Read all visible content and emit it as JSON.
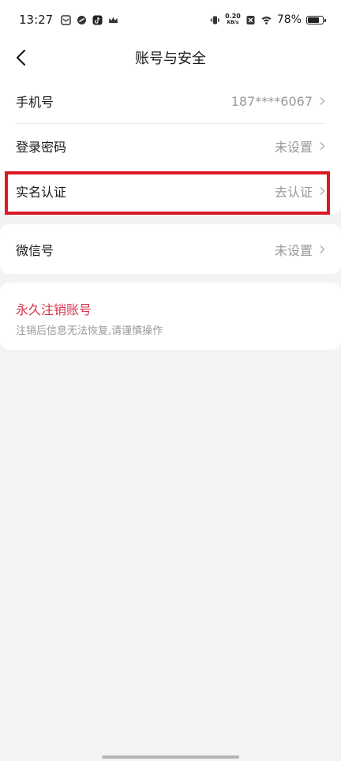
{
  "status_bar": {
    "time": "13:27",
    "net_speed_value": "0.20",
    "net_speed_unit": "KB/s",
    "battery_percent": "78%",
    "battery_level": 0.78,
    "icons": [
      "mail-icon",
      "link-icon",
      "tiktok-icon",
      "crown-icon",
      "vibrate-icon",
      "sim-off-icon",
      "wifi-icon",
      "battery-icon"
    ]
  },
  "header": {
    "title": "账号与安全"
  },
  "account_rows": [
    {
      "label": "手机号",
      "value": "187****6067"
    },
    {
      "label": "登录密码",
      "value": "未设置"
    },
    {
      "label": "实名认证",
      "value": "去认证"
    }
  ],
  "wechat_row": {
    "label": "微信号",
    "value": "未设置"
  },
  "cancel_account": {
    "title": "永久注销账号",
    "subtitle": "注销后信息无法恢复,请谨慎操作"
  },
  "colors": {
    "highlight": "#dd1822",
    "danger_text": "#d8354d",
    "background": "#f2f3f5"
  }
}
